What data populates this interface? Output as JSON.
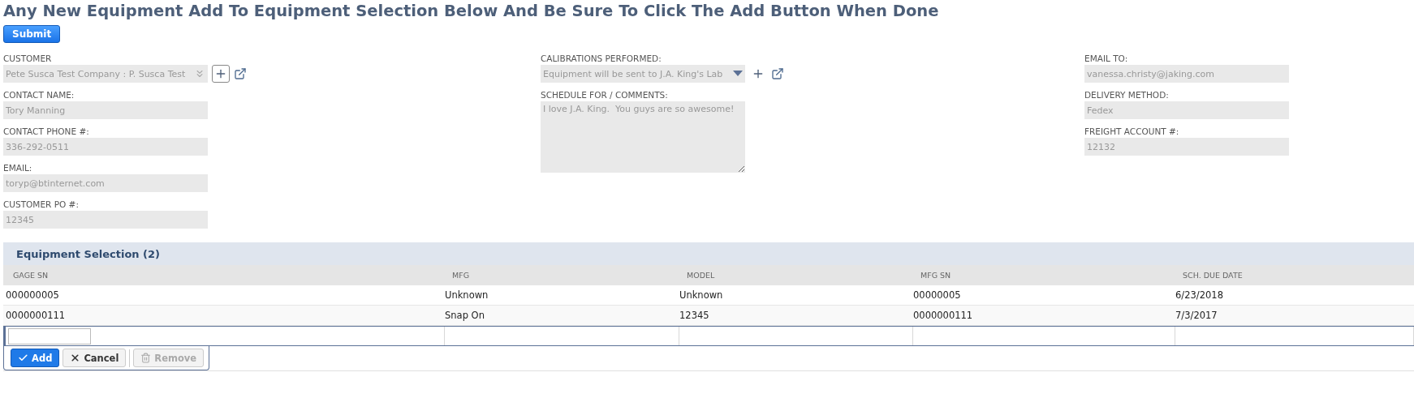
{
  "title": "Any New Equipment Add To Equipment Selection Below And Be Sure To Click The Add Button When Done",
  "submit_button": "Submit",
  "columns": [
    [
      {
        "label": "CUSTOMER",
        "value": "Pete Susca Test Company : P. Susca Test",
        "kind": "combo"
      },
      {
        "label": "CONTACT NAME:",
        "value": "Tory Manning",
        "kind": "text"
      },
      {
        "label": "CONTACT PHONE #:",
        "value": "336-292-0511",
        "kind": "text"
      },
      {
        "label": "EMAIL:",
        "value": "toryp@btinternet.com",
        "kind": "text"
      },
      {
        "label": "CUSTOMER PO #:",
        "value": "12345",
        "kind": "text"
      }
    ],
    [
      {
        "label": "CALIBRATIONS PERFORMED:",
        "value": "Equipment will be sent to J.A. King's Lab",
        "kind": "dropdown"
      },
      {
        "label": "SCHEDULE FOR / COMMENTS:",
        "value": "I love J.A. King.  You guys are so awesome!",
        "kind": "textarea"
      }
    ],
    [
      {
        "label": "EMAIL TO:",
        "value": "vanessa.christy@jaking.com",
        "kind": "text"
      },
      {
        "label": "DELIVERY METHOD:",
        "value": "Fedex",
        "kind": "text"
      },
      {
        "label": "FREIGHT ACCOUNT #:",
        "value": "12132",
        "kind": "text"
      }
    ]
  ],
  "table": {
    "title": "Equipment Selection (2)",
    "columns": [
      "GAGE SN",
      "MFG",
      "MODEL",
      "MFG SN",
      "SCH. DUE DATE"
    ],
    "rows": [
      [
        "000000005",
        "Unknown",
        "Unknown",
        "00000005",
        "6/23/2018"
      ],
      [
        "0000000111",
        "Snap On",
        "12345",
        "0000000111",
        "7/3/2017"
      ]
    ],
    "buttons": [
      {
        "label": "Add",
        "kind": "primary",
        "disabled": false
      },
      {
        "label": "Cancel",
        "kind": "cancel",
        "disabled": false
      },
      {
        "label": "Remove",
        "kind": "remove",
        "disabled": true
      }
    ]
  }
}
